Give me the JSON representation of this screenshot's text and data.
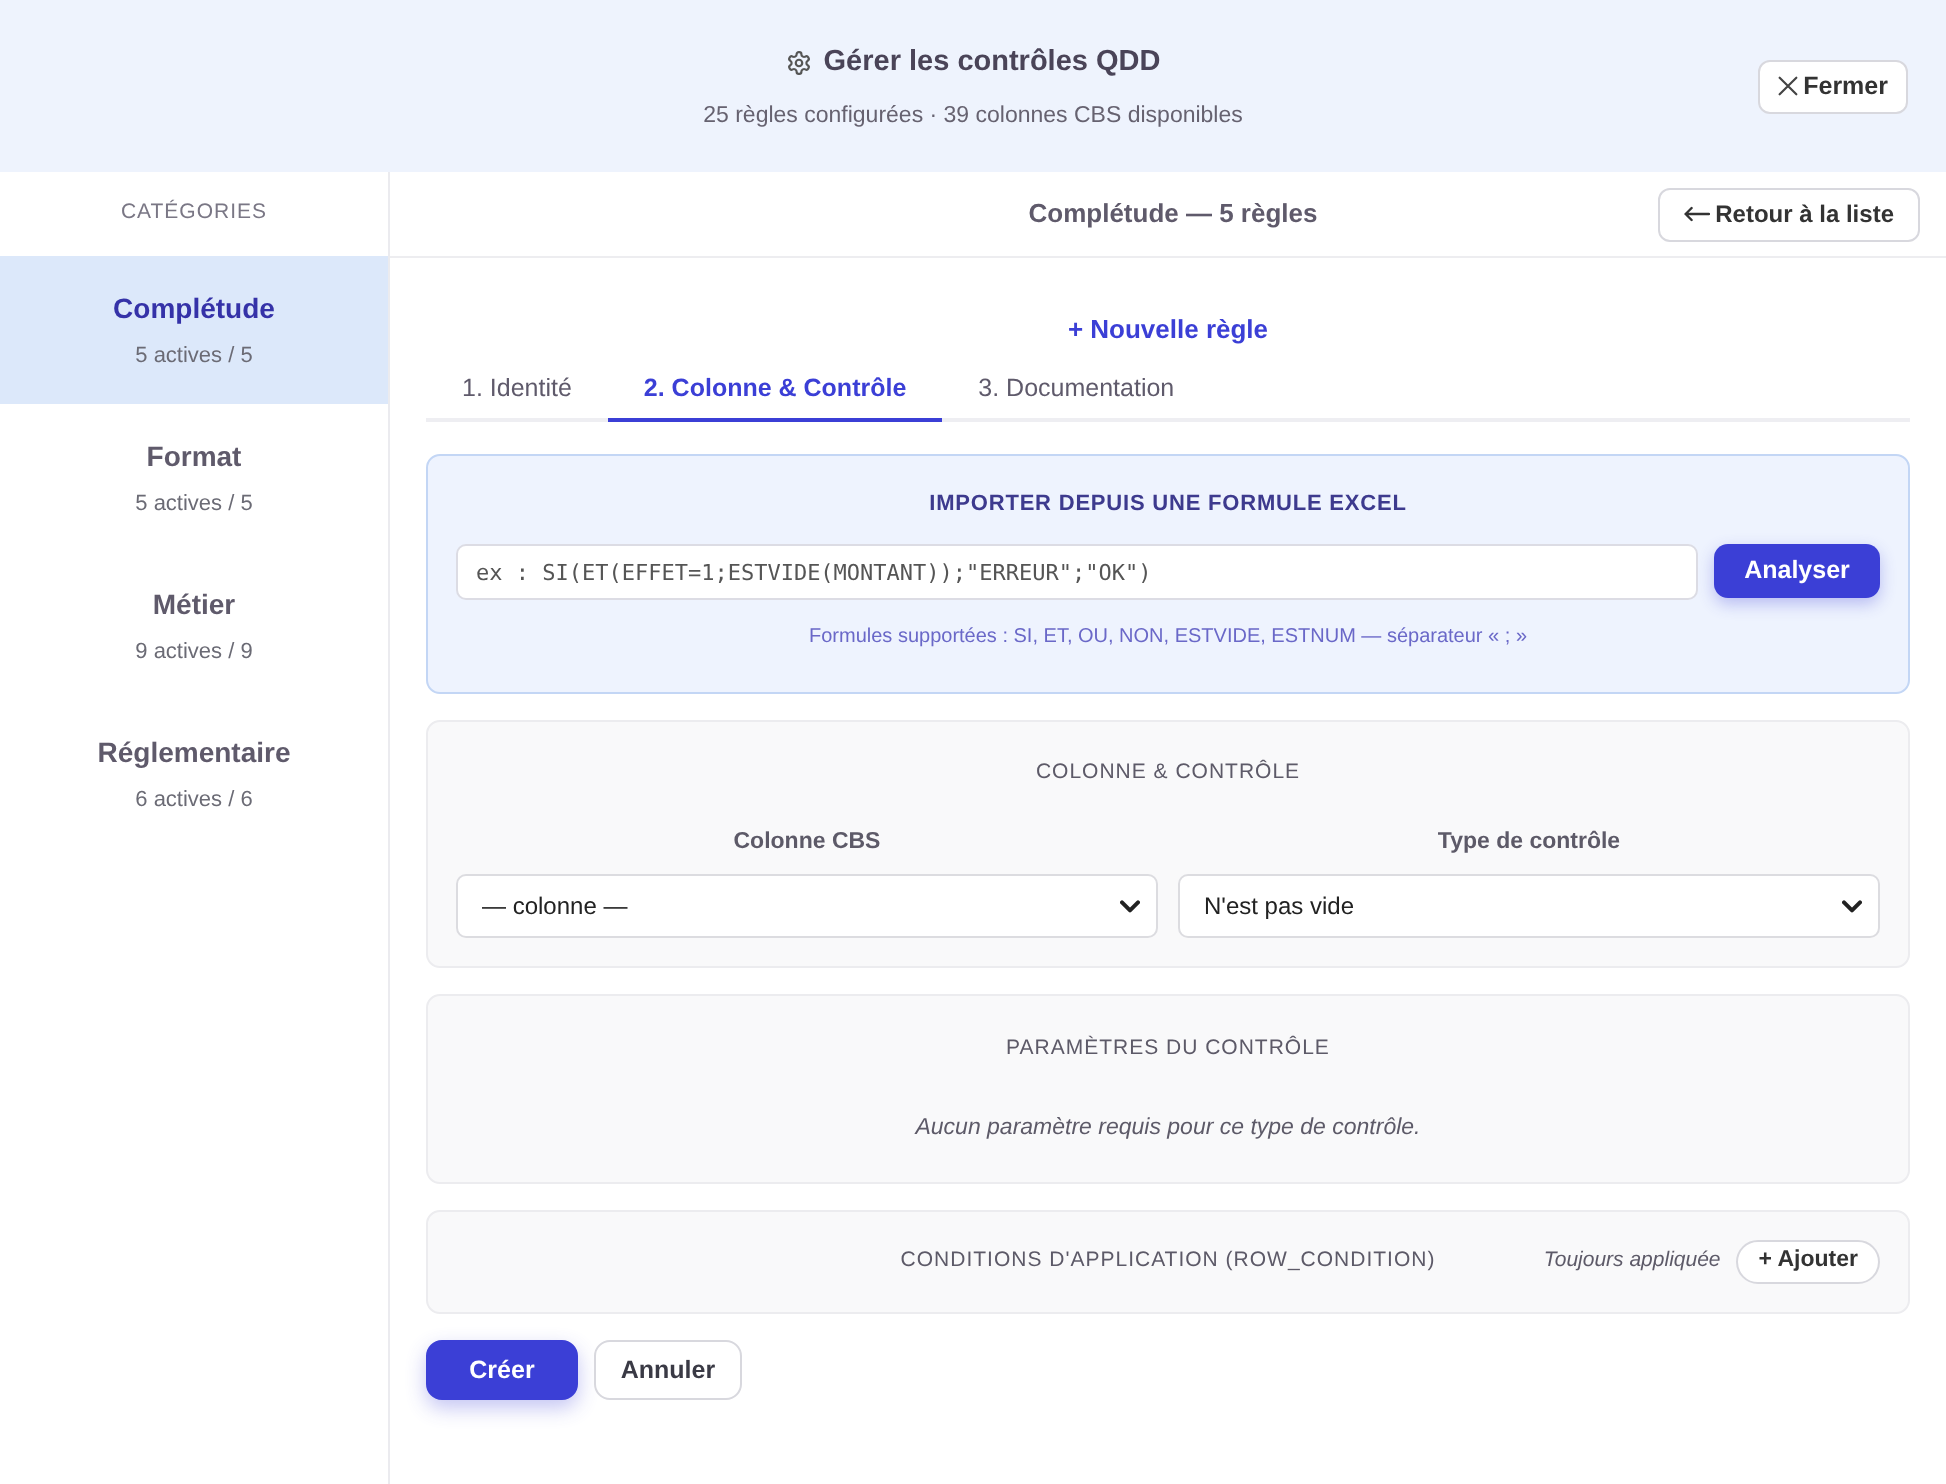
{
  "header": {
    "title": "Gérer les contrôles QDD",
    "subtitle": "25 règles configurées · 39 colonnes CBS disponibles",
    "close_button": "Fermer"
  },
  "sidebar": {
    "heading": "CATÉGORIES",
    "items": [
      {
        "name": "Complétude",
        "count": "5 actives / 5",
        "selected": true
      },
      {
        "name": "Format",
        "count": "5 actives / 5",
        "selected": false
      },
      {
        "name": "Métier",
        "count": "9 actives / 9",
        "selected": false
      },
      {
        "name": "Réglementaire",
        "count": "6 actives / 6",
        "selected": false
      }
    ]
  },
  "main": {
    "heading": "Complétude — 5 règles",
    "back_button": "Retour à la liste",
    "form_title": "+ Nouvelle règle",
    "tabs": [
      {
        "label": "1. Identité",
        "selected": false
      },
      {
        "label": "2. Colonne & Contrôle",
        "selected": true
      },
      {
        "label": "3. Documentation",
        "selected": false
      }
    ],
    "import": {
      "title": "IMPORTER DEPUIS UNE FORMULE EXCEL",
      "placeholder": "ex : SI(ET(EFFET=1;ESTVIDE(MONTANT));\"ERREUR\";\"OK\")",
      "button": "Analyser",
      "hint": "Formules supportées : SI, ET, OU, NON, ESTVIDE, ESTNUM — séparateur « ; »"
    },
    "column_control": {
      "title": "COLONNE & CONTRÔLE",
      "fields": [
        {
          "label": "Colonne CBS",
          "value": "— colonne —"
        },
        {
          "label": "Type de contrôle",
          "value": "N'est pas vide"
        }
      ]
    },
    "parameters": {
      "title": "PARAMÈTRES DU CONTRÔLE",
      "message": "Aucun paramètre requis pour ce type de contrôle."
    },
    "conditions": {
      "title": "CONDITIONS D'APPLICATION (ROW_CONDITION)",
      "status": "Toujours appliquée",
      "add_button": "+ Ajouter"
    },
    "actions": [
      {
        "label": "Créer",
        "kind": "primary"
      },
      {
        "label": "Annuler",
        "kind": "secondary"
      }
    ]
  }
}
